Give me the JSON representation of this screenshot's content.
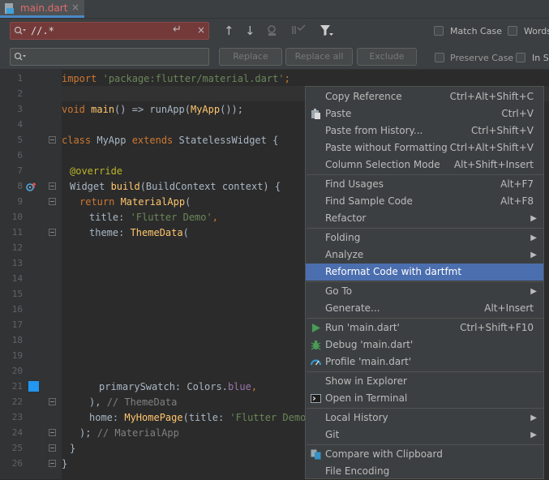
{
  "tab": {
    "label": "main.dart",
    "close": "×"
  },
  "find": {
    "search_value": "//.*",
    "replace_value": "",
    "enter_glyph": "↵",
    "clear_glyph": "×",
    "buttons": {
      "replace": "Replace",
      "replace_all": "Replace all",
      "exclude": "Exclude"
    },
    "options": {
      "match_case": "Match Case",
      "words": "Words",
      "preserve_case": "Preserve Case",
      "in_selection": "In Se"
    }
  },
  "line_numbers": [
    "1",
    "2",
    "3",
    "4",
    "5",
    "6",
    "7",
    "8",
    "9",
    "10",
    "11",
    "12",
    "13",
    "14",
    "15",
    "16",
    "17",
    "18",
    "19",
    "20",
    "21",
    "22",
    "23",
    "24",
    "25",
    "26"
  ],
  "code": {
    "l1_kw": "import",
    "l1_str": "'package:flutter/material.dart'",
    "l1_end": ";",
    "l3_kw": "void",
    "l3_fn": "main",
    "l3_mid": "() => runApp(",
    "l3_fn2": "MyApp",
    "l3_end": "());",
    "l5_kw": "class",
    "l5_name": " MyApp ",
    "l5_kw2": "extends",
    "l5_rest": " StatelessWidget {",
    "l7_ann": "@override",
    "l8_type": "Widget ",
    "l8_fn": "build",
    "l8_rest": "(BuildContext context) {",
    "l9_kw": "return",
    "l9_fn": " MaterialApp",
    "l9_end": "(",
    "l10_label": "title: ",
    "l10_str": "'Flutter Demo'",
    "l10_end": ",",
    "l11_label": "theme: ",
    "l11_fn": "ThemeData",
    "l11_end": "(",
    "l21_label": "primarySwatch: Colors.",
    "l21_fld": "blue",
    "l21_end": ",",
    "l22_code": "), ",
    "l22_cm": "// ThemeData",
    "l23_label": "home: ",
    "l23_fn": "MyHomePage",
    "l23_mid": "(title: ",
    "l23_str": "'Flutter Demo Home Pa",
    "l24_code": "); ",
    "l24_cm": "// MaterialApp",
    "l25_code": "}",
    "l26_code": "}"
  },
  "menu": {
    "items": [
      {
        "label": "Copy Reference",
        "shortcut": "Ctrl+Alt+Shift+C"
      },
      {
        "label": "Paste",
        "shortcut": "Ctrl+V",
        "icon": "paste-icon"
      },
      {
        "label": "Paste from History...",
        "shortcut": "Ctrl+Shift+V"
      },
      {
        "label": "Paste without Formatting",
        "shortcut": "Ctrl+Alt+Shift+V"
      },
      {
        "label": "Column Selection Mode",
        "shortcut": "Alt+Shift+Insert"
      },
      {
        "label": "Find Usages",
        "shortcut": "Alt+F7"
      },
      {
        "label": "Find Sample Code",
        "shortcut": "Alt+F8"
      },
      {
        "label": "Refactor",
        "submenu": true
      },
      {
        "label": "Folding",
        "submenu": true
      },
      {
        "label": "Analyze",
        "submenu": true
      },
      {
        "label": "Reformat Code with dartfmt",
        "selected": true
      },
      {
        "label": "Go To",
        "submenu": true
      },
      {
        "label": "Generate...",
        "shortcut": "Alt+Insert"
      },
      {
        "label": "Run 'main.dart'",
        "shortcut": "Ctrl+Shift+F10",
        "icon": "run-icon"
      },
      {
        "label": "Debug 'main.dart'",
        "icon": "debug-icon"
      },
      {
        "label": "Profile 'main.dart'",
        "icon": "profile-icon"
      },
      {
        "label": "Show in Explorer"
      },
      {
        "label": "Open in Terminal",
        "icon": "terminal-icon"
      },
      {
        "label": "Local History",
        "submenu": true
      },
      {
        "label": "Git",
        "submenu": true
      },
      {
        "label": "Compare with Clipboard",
        "icon": "compare-icon"
      },
      {
        "label": "File Encoding"
      }
    ]
  },
  "colors": {
    "selected": "#4b6eaf",
    "search_error_bg": "#743a3a",
    "swatch_blue": "#2196f3"
  }
}
